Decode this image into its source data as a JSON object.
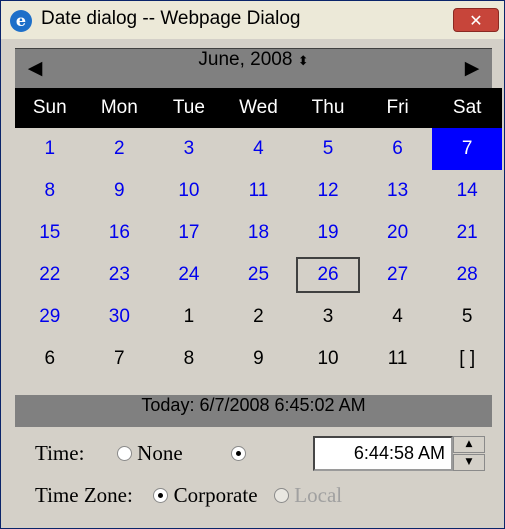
{
  "window": {
    "title": "Date dialog -- Webpage Dialog",
    "icon": "ie-icon",
    "close_glyph": "✕"
  },
  "calendar": {
    "month_label": "June, 2008",
    "prev_glyph": "◀",
    "next_glyph": "▶",
    "spin_glyph": "⬍",
    "weekdays": [
      "Sun",
      "Mon",
      "Tue",
      "Wed",
      "Thu",
      "Fri",
      "Sat"
    ],
    "weeks": [
      [
        "1",
        "2",
        "3",
        "4",
        "5",
        "6",
        "7"
      ],
      [
        "8",
        "9",
        "10",
        "11",
        "12",
        "13",
        "14"
      ],
      [
        "15",
        "16",
        "17",
        "18",
        "19",
        "20",
        "21"
      ],
      [
        "22",
        "23",
        "24",
        "25",
        "26",
        "27",
        "28"
      ],
      [
        "29",
        "30",
        "1",
        "2",
        "3",
        "4",
        "5"
      ],
      [
        "6",
        "7",
        "8",
        "9",
        "10",
        "11",
        "[ ]"
      ]
    ],
    "selected_day": "7",
    "today_day": "26",
    "today_label": "Today: 6/7/2008 6:45:02 AM"
  },
  "time": {
    "label": "Time:",
    "none_option": "None",
    "value": "6:44:58 AM",
    "none_selected": false,
    "custom_selected": true
  },
  "timezone": {
    "label": "Time Zone:",
    "corporate_option": "Corporate",
    "local_option": "Local",
    "corporate_selected": true,
    "local_disabled": true
  },
  "colors": {
    "day_link": "#0000ee",
    "selected_bg": "#0000ff",
    "header_bg": "#000000",
    "nav_bg": "#808080",
    "dialog_bg": "#d4d0c8"
  }
}
